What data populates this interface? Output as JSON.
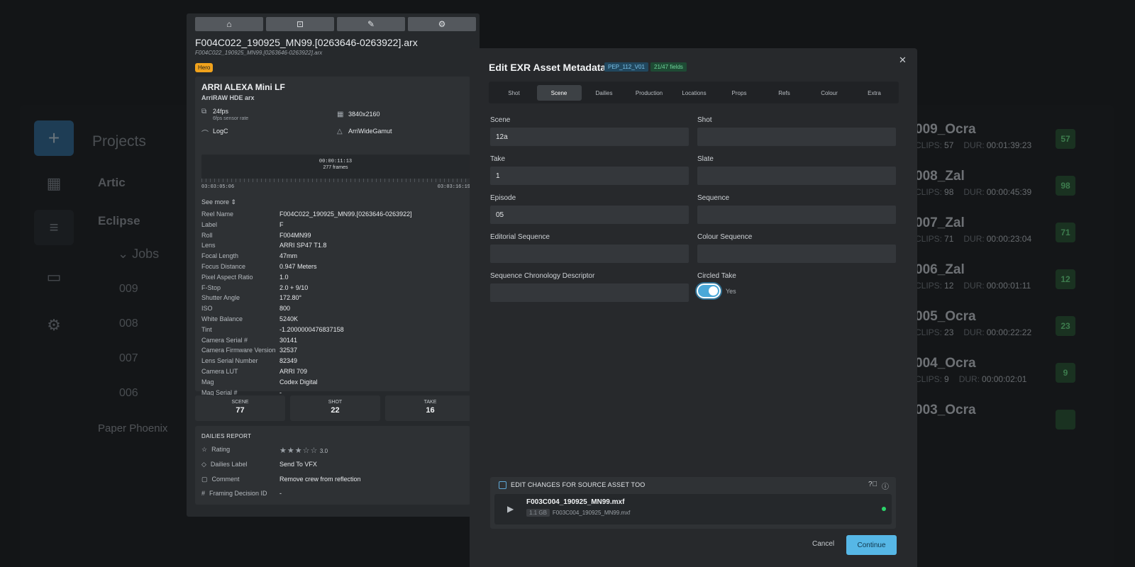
{
  "background": {
    "title": "Projects",
    "projects": [
      "Artic",
      "Eclipse"
    ],
    "jobs_label": "Jobs",
    "job_numbers": [
      "009",
      "008",
      "007",
      "006"
    ],
    "extra_project": "Paper Phoenix",
    "jobs": [
      {
        "name": "009_Ocra",
        "clips": "57",
        "dur": "00:01:39:23",
        "badge": "57"
      },
      {
        "name": "008_Zal",
        "clips": "98",
        "dur": "00:00:45:39",
        "badge": "98"
      },
      {
        "name": "007_Zal",
        "clips": "71",
        "dur": "00:00:23:04",
        "badge": "71"
      },
      {
        "name": "006_Zal",
        "clips": "12",
        "dur": "00:00:01:11",
        "badge": "12"
      },
      {
        "name": "005_Ocra",
        "clips": "23",
        "dur": "00:00:22:22",
        "badge": "23"
      },
      {
        "name": "004_Ocra",
        "clips": "9",
        "dur": "00:00:02:01",
        "badge": "9"
      },
      {
        "name": "003_Ocra",
        "clips": "",
        "dur": "",
        "badge": ""
      }
    ],
    "clips_label": "CLIPS:",
    "dur_label": "DUR:"
  },
  "asset": {
    "file_name": "F004C022_190925_MN99.[0263646-0263922].arx",
    "file_sub": "F004C022_190925_MN99.[0263646-0263922].arx",
    "badge": "Hero",
    "camera": "ARRI ALEXA Mini LF",
    "codec": "ArriRAW HDE arx",
    "fps": "24fps",
    "sensor_rate": "6fps sensor rate",
    "resolution": "3840x2160",
    "log": "LogC",
    "gamut": "ArriWideGamut",
    "duration_tc": "00:00:11:13",
    "frames": "277 frames",
    "tc_start": "03:03:05:06",
    "tc_end": "03:03:16:19",
    "see_more": "See more",
    "metadata": [
      {
        "k": "Reel Name",
        "v": "F004C022_190925_MN99.[0263646-0263922]"
      },
      {
        "k": "Label",
        "v": "F"
      },
      {
        "k": "Roll",
        "v": "F004MN99"
      },
      {
        "k": "Lens",
        "v": "ARRI SP47 T1.8"
      },
      {
        "k": "Focal Length",
        "v": "47mm"
      },
      {
        "k": "Focus Distance",
        "v": "0.947 Meters"
      },
      {
        "k": "Pixel Aspect Ratio",
        "v": "1.0"
      },
      {
        "k": "F-Stop",
        "v": "2.0 + 9/10"
      },
      {
        "k": "Shutter Angle",
        "v": "172.80°"
      },
      {
        "k": "ISO",
        "v": "800"
      },
      {
        "k": "White Balance",
        "v": "5240K"
      },
      {
        "k": "Tint",
        "v": "-1.2000000476837158"
      },
      {
        "k": "Camera Serial #",
        "v": "30141"
      },
      {
        "k": "Camera Firmware Version",
        "v": "32537"
      },
      {
        "k": "Lens Serial Number",
        "v": "82349"
      },
      {
        "k": "Camera LUT",
        "v": "ARRI 709"
      },
      {
        "k": "Mag",
        "v": "Codex Digital"
      },
      {
        "k": "Mag Serial #",
        "v": "-"
      }
    ],
    "stats": [
      {
        "label": "SCENE",
        "value": "77"
      },
      {
        "label": "SHOT",
        "value": "22"
      },
      {
        "label": "TAKE",
        "value": "16"
      }
    ],
    "dailies": {
      "title": "DAILIES REPORT",
      "rating_label": "Rating",
      "rating_value": "3.0",
      "rating": 3,
      "label_key": "Dailies Label",
      "label_value": "Send To VFX",
      "comment_key": "Comment",
      "comment_value": "Remove crew from reflection",
      "framing_key": "Framing Decision ID",
      "framing_value": "-"
    }
  },
  "modal": {
    "title": "Edit EXR Asset Metadata",
    "chip_version": "PEP_112_V01",
    "chip_fields": "21/47 fields",
    "tabs": [
      "Shot",
      "Scene",
      "Dailies",
      "Production",
      "Locations",
      "Props",
      "Refs",
      "Colour",
      "Extra"
    ],
    "active_tab": "Scene",
    "fields": [
      {
        "label": "Scene",
        "value": "12a"
      },
      {
        "label": "Shot",
        "value": ""
      },
      {
        "label": "Take",
        "value": "1"
      },
      {
        "label": "Slate",
        "value": ""
      },
      {
        "label": "Episode",
        "value": "05"
      },
      {
        "label": "Sequence",
        "value": ""
      },
      {
        "label": "Editorial Sequence",
        "value": ""
      },
      {
        "label": "Colour Sequence",
        "value": ""
      },
      {
        "label": "Sequence Chronology Descriptor",
        "value": ""
      }
    ],
    "circled_label": "Circled Take",
    "circled_value": "Yes",
    "source_label": "EDIT CHANGES FOR SOURCE ASSET TOO",
    "source_asset_name": "F003C004_190925_MN99.mxf",
    "source_asset_size": "1.1 GB",
    "source_asset_sub": "F003C004_190925_MN99.mxf",
    "cancel": "Cancel",
    "continue": "Continue"
  },
  "colors": {
    "accent": "#56b7e6",
    "hero": "#f0a21c",
    "status_ok": "#2bd46a"
  }
}
